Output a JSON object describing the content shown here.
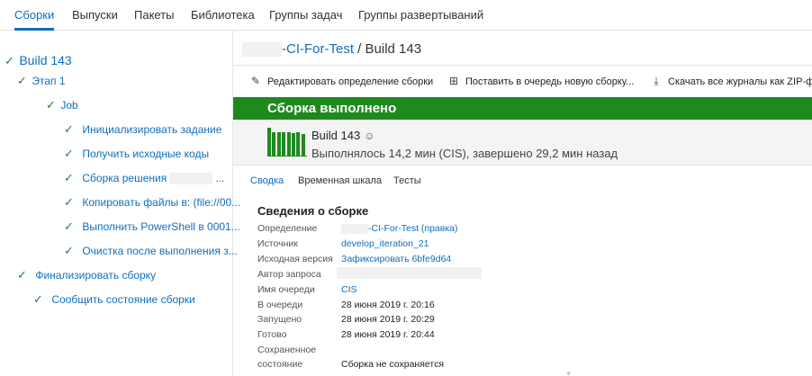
{
  "nav": {
    "tabs": [
      {
        "label": "Сборки"
      },
      {
        "label": "Выпуски"
      },
      {
        "label": "Пакеты"
      },
      {
        "label": "Библиотека"
      },
      {
        "label": "Группы задач"
      },
      {
        "label": "Группы развертываний"
      }
    ],
    "active_index": 0
  },
  "tree": {
    "root": "Build 143",
    "stage": "Этап 1",
    "job": "Job",
    "steps": [
      "Инициализировать задание",
      "Получить исходные коды",
      "Сборка решения",
      "Копировать файлы в: (file://00...",
      "Выполнить PowerShell в 0001...",
      "Очистка после выполнения з..."
    ],
    "step_suffix_2": "...",
    "finalize": "Финализировать сборку",
    "report": "Сообщить состояние сборки"
  },
  "header": {
    "pipeline": "-CI-For-Test",
    "separator": " / ",
    "build": "Build 143"
  },
  "toolbar": {
    "edit": "Редактировать определение сборки",
    "queue": "Поставить в очередь новую сборку...",
    "download": "Скачать все журналы как ZIP-фа"
  },
  "banner": {
    "text": "Сборка выполнено",
    "color": "#1e8a1e"
  },
  "summary": {
    "title": "Build 143",
    "subtitle": "Выполнялось 14,2 мин (CIS), завершено 29,2 мин назад",
    "bar_levels": [
      0.95,
      0.78,
      0.8,
      0.78,
      0.8,
      0.76,
      0.78,
      0.74
    ]
  },
  "subtabs": [
    "Сводка",
    "Временная шкала",
    "Тесты"
  ],
  "details": {
    "title": "Сведения о сборке",
    "rows": [
      {
        "key": "Определение",
        "value": "-CI-For-Test (правка)"
      },
      {
        "key": "Источник",
        "value": "develop_iteration_21"
      },
      {
        "key": "Исходная версия",
        "value": "Зафиксировать 6bfe9d64"
      },
      {
        "key": "Автор запроса",
        "value": ""
      },
      {
        "key": "Имя очереди",
        "value": "CIS"
      },
      {
        "key": "В очереди",
        "value": "28 июня 2019 г. 20:16"
      },
      {
        "key": "Запущено",
        "value": "28 июня 2019 г. 20:29"
      },
      {
        "key": "Готово",
        "value": "28 июня 2019 г. 20:44"
      },
      {
        "key": "Сохраненное",
        "value": ""
      },
      {
        "key": "состояние",
        "value": "Сборка не сохраняется"
      }
    ]
  },
  "icons": {
    "check": "check-icon",
    "person": "person-icon",
    "edit": "pencil-icon",
    "queue": "queue-icon",
    "download": "download-icon"
  },
  "colors": {
    "accent": "#106ebe",
    "success": "#1e8a1e"
  }
}
